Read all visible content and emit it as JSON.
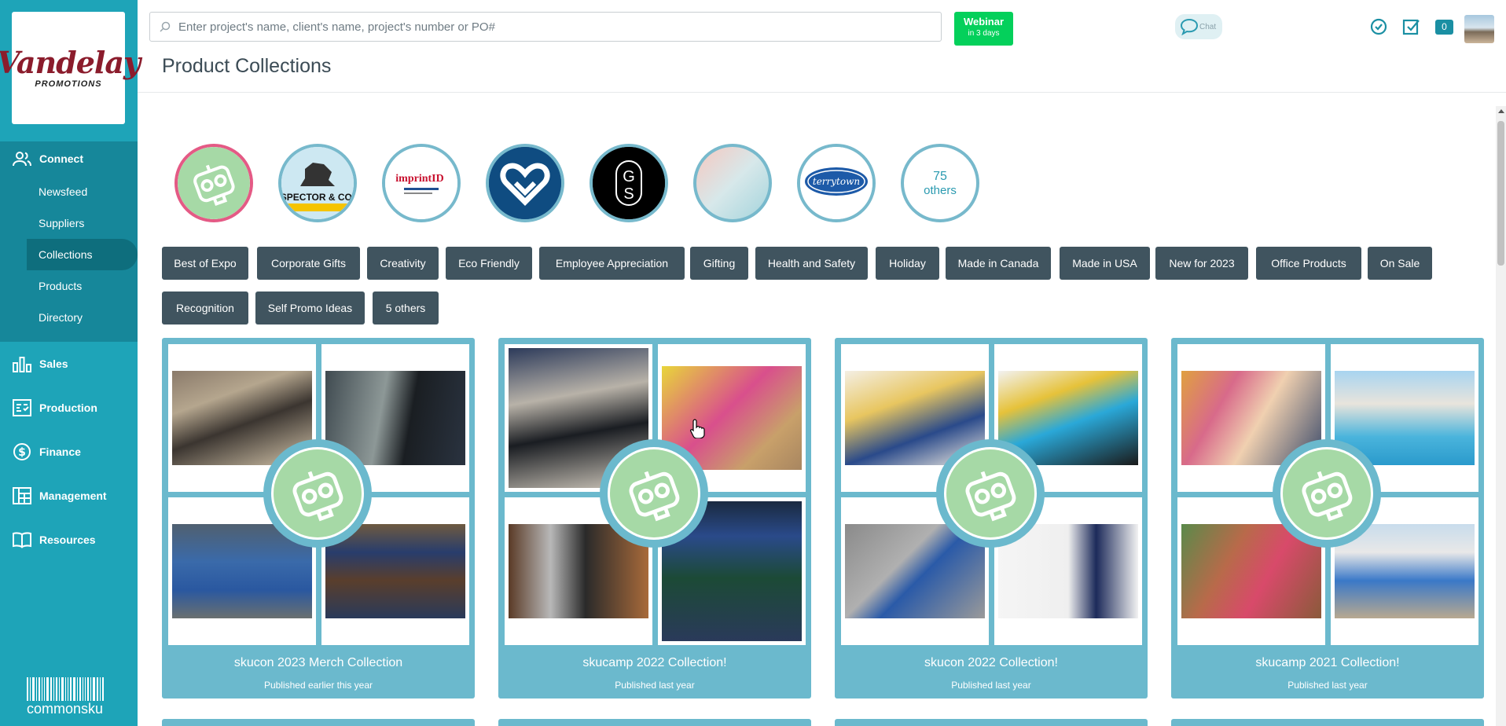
{
  "sidebar": {
    "logo": {
      "main": "Vandelay",
      "sub": "PROMOTIONS"
    },
    "connect": {
      "label": "Connect",
      "items": [
        {
          "label": "Newsfeed"
        },
        {
          "label": "Suppliers"
        },
        {
          "label": "Collections",
          "active": true
        },
        {
          "label": "Products"
        },
        {
          "label": "Directory"
        }
      ]
    },
    "main_items": [
      {
        "label": "Sales",
        "icon": "bar-chart-icon"
      },
      {
        "label": "Production",
        "icon": "production-icon"
      },
      {
        "label": "Finance",
        "icon": "dollar-icon"
      },
      {
        "label": "Management",
        "icon": "management-icon"
      },
      {
        "label": "Resources",
        "icon": "book-icon"
      }
    ],
    "brand": "commonsku"
  },
  "header": {
    "search_placeholder": "Enter project's name, client's name, project's number or PO#",
    "webinar": {
      "title": "Webinar",
      "sub": "in 3 days"
    },
    "chat_label": "Chat",
    "notification_count": "0",
    "page_title": "Product Collections"
  },
  "suppliers": {
    "logos": [
      {
        "name": "robot-mascot",
        "text": ""
      },
      {
        "name": "spector-co",
        "text": "SPECTOR & CO."
      },
      {
        "name": "imprint-id",
        "text": "imprintID"
      },
      {
        "name": "heart",
        "text": ""
      },
      {
        "name": "gs",
        "text": "GS"
      },
      {
        "name": "gradient",
        "text": ""
      },
      {
        "name": "terrytown",
        "text": "terrytown"
      }
    ],
    "others": {
      "count": "75",
      "label": "others"
    }
  },
  "tags": [
    "Best of Expo",
    "Corporate Gifts",
    "Creativity",
    "Eco Friendly",
    "Employee Appreciation",
    "Gifting",
    "Health and Safety",
    "Holiday",
    "Made in Canada",
    "Made in USA",
    "New for 2023",
    "Office Products",
    "On Sale",
    "Recognition",
    "Self Promo Ideas",
    "5 others"
  ],
  "collections": [
    {
      "title": "skucon 2023 Merch Collection",
      "published": "Published earlier this year"
    },
    {
      "title": "skucamp 2022 Collection!",
      "published": "Published last year"
    },
    {
      "title": "skucon 2022 Collection!",
      "published": "Published last year"
    },
    {
      "title": "skucamp 2021 Collection!",
      "published": "Published last year"
    }
  ],
  "colors": {
    "sidebar": "#1ea4b8",
    "sidebar_dark": "#16879a",
    "tag": "#40545f",
    "card": "#6bb9cd",
    "webinar": "#04d05b"
  }
}
